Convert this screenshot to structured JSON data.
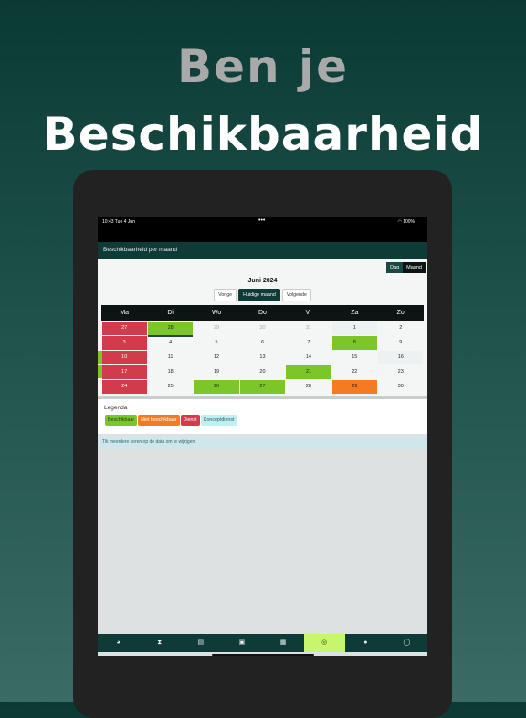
{
  "promo": {
    "line1": "Ben je",
    "line2": "Beschikbaarheid"
  },
  "status_bar": {
    "time": "10:43   Tue 4 Jun",
    "dots": "•••",
    "battery": "100%"
  },
  "app_bar": {
    "title": "Beschikbaarheid per maand"
  },
  "view_toggle": {
    "day": "Dag",
    "month": "Maand",
    "selected": "Maand"
  },
  "calendar": {
    "month_title": "Juni 2024",
    "nav": {
      "prev": "Vorige",
      "current": "Huidige maand",
      "next": "Volgende"
    },
    "weekdays": [
      "Ma",
      "Di",
      "Wo",
      "Do",
      "Vr",
      "Za",
      "Zo"
    ],
    "weeks": [
      [
        {
          "d": "27",
          "s": "red"
        },
        {
          "d": "28",
          "s": "green"
        },
        {
          "d": "29",
          "s": "gray"
        },
        {
          "d": "30",
          "s": "gray"
        },
        {
          "d": "31",
          "s": "gray"
        },
        {
          "d": "1",
          "s": "light"
        },
        {
          "d": "2",
          "s": ""
        }
      ],
      [
        {
          "d": "3",
          "s": "red"
        },
        {
          "d": "4",
          "s": ""
        },
        {
          "d": "5",
          "s": ""
        },
        {
          "d": "6",
          "s": ""
        },
        {
          "d": "7",
          "s": ""
        },
        {
          "d": "8",
          "s": "green"
        },
        {
          "d": "9",
          "s": ""
        }
      ],
      [
        {
          "d": "10",
          "s": "red"
        },
        {
          "d": "11",
          "s": ""
        },
        {
          "d": "12",
          "s": ""
        },
        {
          "d": "13",
          "s": ""
        },
        {
          "d": "14",
          "s": ""
        },
        {
          "d": "15",
          "s": ""
        },
        {
          "d": "16",
          "s": "light"
        }
      ],
      [
        {
          "d": "17",
          "s": "red"
        },
        {
          "d": "18",
          "s": ""
        },
        {
          "d": "19",
          "s": ""
        },
        {
          "d": "20",
          "s": ""
        },
        {
          "d": "21",
          "s": "green"
        },
        {
          "d": "22",
          "s": ""
        },
        {
          "d": "23",
          "s": ""
        }
      ],
      [
        {
          "d": "24",
          "s": "red"
        },
        {
          "d": "25",
          "s": ""
        },
        {
          "d": "26",
          "s": "green"
        },
        {
          "d": "27",
          "s": "green"
        },
        {
          "d": "28",
          "s": ""
        },
        {
          "d": "29",
          "s": "orange"
        },
        {
          "d": "30",
          "s": ""
        }
      ]
    ],
    "left_markers": [
      "",
      "",
      "green",
      "green",
      ""
    ]
  },
  "legend": {
    "title": "Legenda",
    "items": [
      {
        "label": "Beschikbaar",
        "color": "green"
      },
      {
        "label": "Niet beschikbaar",
        "color": "orange"
      },
      {
        "label": "Dienst",
        "color": "red"
      },
      {
        "label": "Conceptdienst",
        "color": "cyan"
      }
    ]
  },
  "info": {
    "text": "Tik meerdere keren op de data om te wijzigen."
  },
  "tabs": [
    {
      "icon": "dashboard-icon",
      "glyph": "◕"
    },
    {
      "icon": "hourglass-icon",
      "glyph": "⧗"
    },
    {
      "icon": "id-card-icon",
      "glyph": "▤"
    },
    {
      "icon": "badge-icon",
      "glyph": "▣"
    },
    {
      "icon": "calendar-icon",
      "glyph": "▦"
    },
    {
      "icon": "availability-icon",
      "glyph": "◎",
      "active": true
    },
    {
      "icon": "chat-icon",
      "glyph": "●"
    },
    {
      "icon": "profile-icon",
      "glyph": "◯"
    }
  ],
  "colors": {
    "accent_dark": "#0f3b37",
    "available": "#7cc62a",
    "unavailable": "#f47b22",
    "shift": "#d23b4b",
    "concept": "#bff0f4",
    "active_tab": "#c6f56e"
  }
}
